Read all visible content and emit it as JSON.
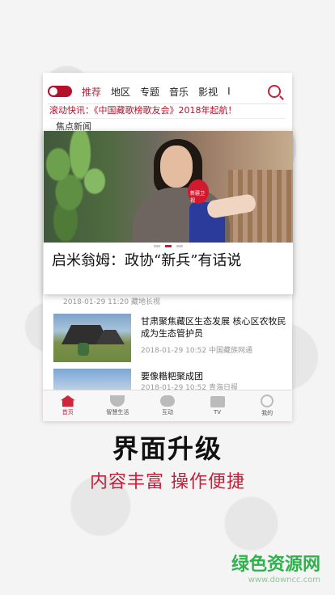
{
  "nav": {
    "tabs": [
      "推荐",
      "地区",
      "专题",
      "音乐",
      "影视",
      "I"
    ],
    "active_tab_index": 0,
    "search_icon": "search-icon"
  },
  "ticker": {
    "text": "滚动快讯：《中国藏歌榜歌友会》2018年起航！"
  },
  "section": {
    "title": "焦点新闻"
  },
  "featured": {
    "title": "启米翁姆：政协“新兵”有话说",
    "mic_label": "新疆卫视"
  },
  "ghost_timestamp": "2018-01-29 11:20 藏地长视",
  "news": [
    {
      "title": "甘肃聚焦藏区生态发展 核心区农牧民成为生态管护员",
      "date": "2018-01-29 10:52",
      "source": "中国藏族网通"
    },
    {
      "title": "要像糌粑聚成团",
      "date": "2018-01-29 10:52",
      "source": "青海日报"
    }
  ],
  "bottom_nav": {
    "items": [
      {
        "label": "首页",
        "icon": "home-icon"
      },
      {
        "label": "智慧生活",
        "icon": "bowl-icon"
      },
      {
        "label": "互动",
        "icon": "chat-icon"
      },
      {
        "label": "TV",
        "icon": "tv-icon"
      },
      {
        "label": "我的",
        "icon": "user-icon"
      }
    ],
    "active_index": 0
  },
  "promo": {
    "headline": "界面升级",
    "subline": "内容丰富 操作便捷"
  },
  "watermark": {
    "main": "绿色资源网",
    "sub": "www.downcc.com"
  },
  "colors": {
    "accent": "#c4203c",
    "brand": "#b3122a",
    "watermark": "#2eb24b"
  }
}
